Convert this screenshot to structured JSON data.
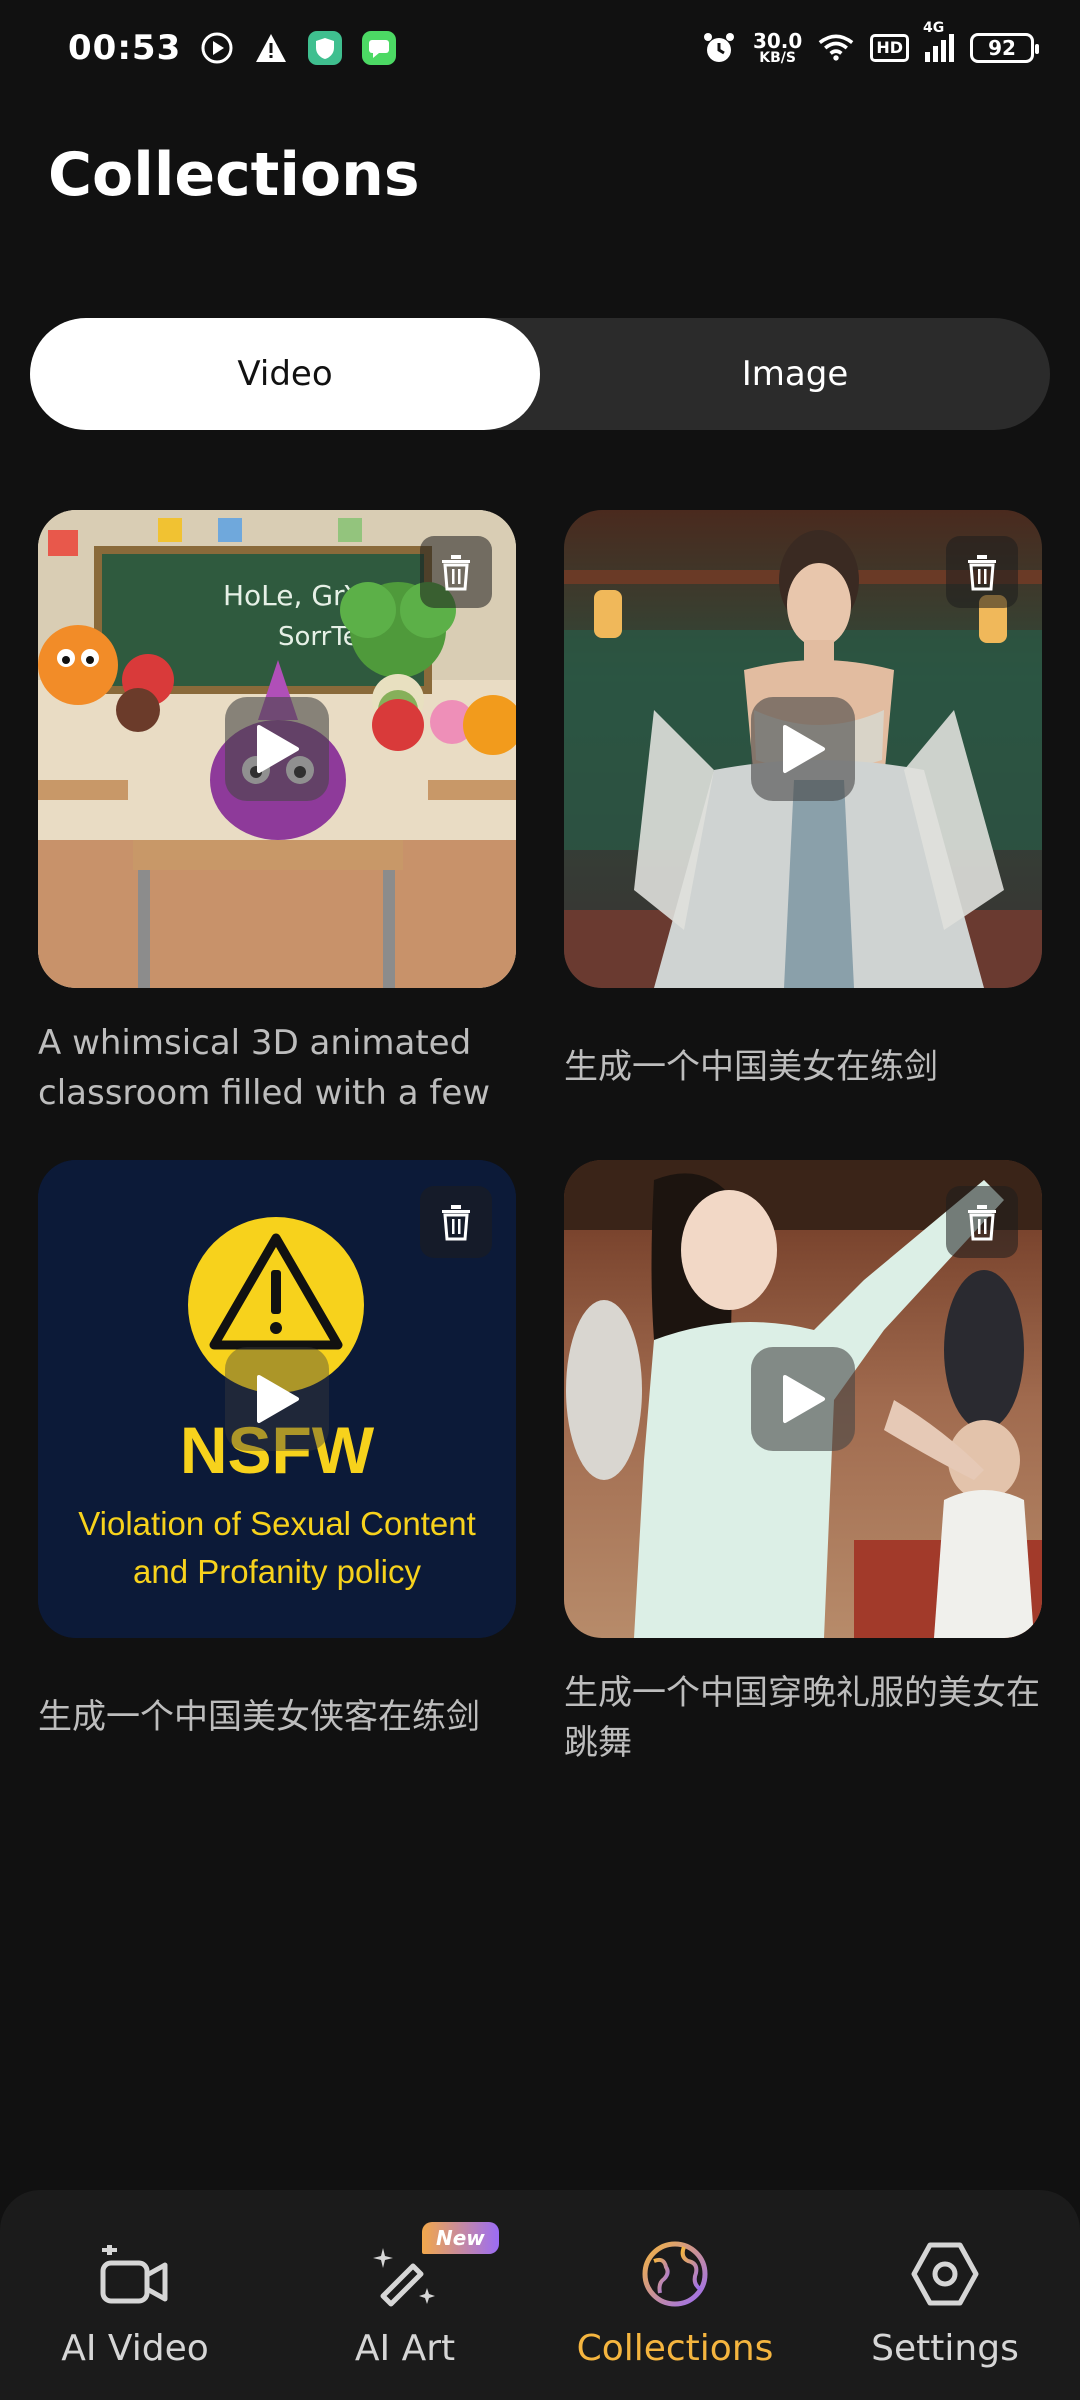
{
  "status_bar": {
    "time": "00:53",
    "net_speed_value": "30.0",
    "net_speed_unit": "KB/S",
    "hd": "HD",
    "network": "4G",
    "battery": "92"
  },
  "header": {
    "title": "Collections"
  },
  "tabs": [
    {
      "label": "Video",
      "active": true
    },
    {
      "label": "Image",
      "active": false
    }
  ],
  "items": [
    {
      "caption": "A whimsical 3D animated classroom filled with a few ..."
    },
    {
      "caption": "生成一个中国美女在练剑"
    },
    {
      "caption": "生成一个中国美女侠客在练剑",
      "overlay_title": "NSFW",
      "overlay_text": "Violation of Sexual Content and Profanity policy"
    },
    {
      "caption": "生成一个中国穿晚礼服的美女在跳舞"
    }
  ],
  "thumb1_board_text": [
    "HoLe, GrYoE?",
    "SorrTeL"
  ],
  "bottom_nav": {
    "items": [
      {
        "label": "AI Video",
        "icon": "video-camera-icon",
        "active": false
      },
      {
        "label": "AI Art",
        "icon": "magic-wand-icon",
        "active": false,
        "badge": "New"
      },
      {
        "label": "Collections",
        "icon": "globe-icon",
        "active": true
      },
      {
        "label": "Settings",
        "icon": "hexagon-gear-icon",
        "active": false
      }
    ]
  },
  "colors": {
    "background": "#111111",
    "accent": "#f5b53f",
    "nsfw_yellow": "#f7d21c",
    "nsfw_bg": "#0c1a38"
  }
}
